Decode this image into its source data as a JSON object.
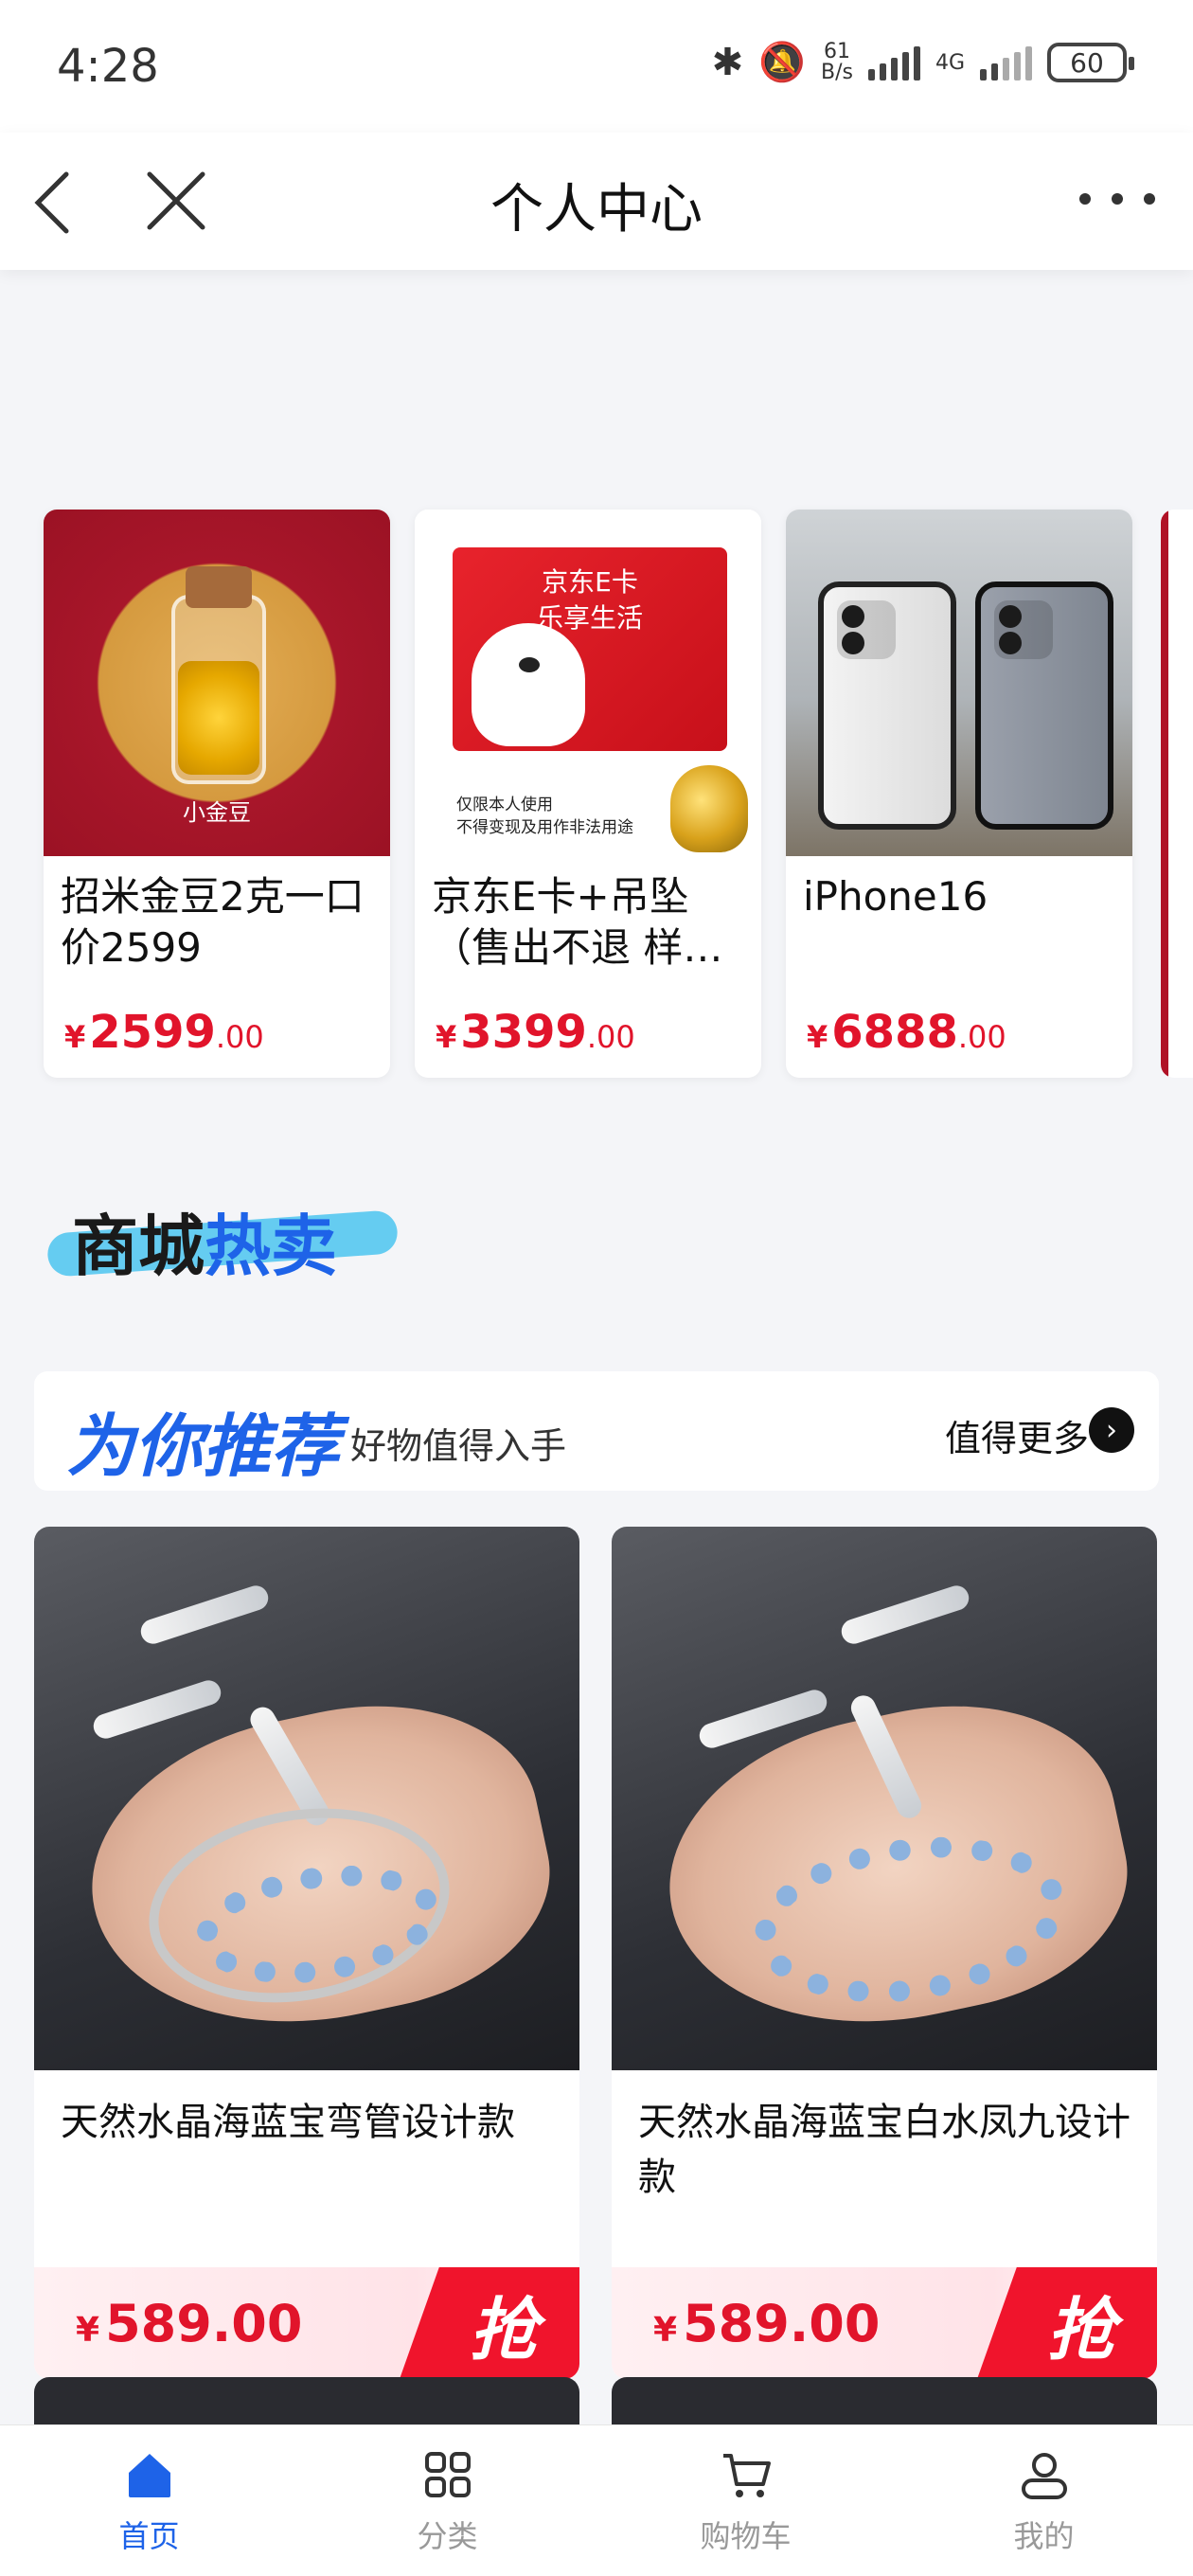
{
  "status_bar": {
    "time": "4:28",
    "net_speed": "61",
    "net_speed_unit": "B/s",
    "network": "4G",
    "battery": "60"
  },
  "nav": {
    "title": "个人中心"
  },
  "products": [
    {
      "name": "招米金豆2克一口价2599",
      "currency": "¥",
      "price_int": "2599",
      "price_dec": ".00",
      "image_label": "小金豆"
    },
    {
      "name": "京东E卡+吊坠（售出不退 样…",
      "currency": "¥",
      "price_int": "3399",
      "price_dec": ".00",
      "image_title": "京东E卡\n乐享生活",
      "image_note": "仅限本人使用\n不得变现及用作非法用途"
    },
    {
      "name": "iPhone16",
      "currency": "¥",
      "price_int": "6888",
      "price_dec": ".00"
    }
  ],
  "mall_section": {
    "title_part1": "商城",
    "title_part2": "热卖"
  },
  "recommend": {
    "title": "为你推荐",
    "subtitle": "好物值得入手",
    "more": "值得更多",
    "arrow": "›"
  },
  "grid_items": [
    {
      "name": "天然水晶海蓝宝弯管设计款",
      "currency": "¥",
      "price": "589.00",
      "grab": "抢"
    },
    {
      "name": "天然水晶海蓝宝白水凤九设计款",
      "currency": "¥",
      "price": "589.00",
      "grab": "抢"
    }
  ],
  "tabbar": [
    {
      "label": "首页",
      "icon": "home-icon",
      "active": true
    },
    {
      "label": "分类",
      "icon": "grid-icon",
      "active": false
    },
    {
      "label": "购物车",
      "icon": "cart-icon",
      "active": false
    },
    {
      "label": "我的",
      "icon": "user-icon",
      "active": false
    }
  ],
  "colors": {
    "accent": "#1e63e8",
    "price": "#e1142b"
  }
}
